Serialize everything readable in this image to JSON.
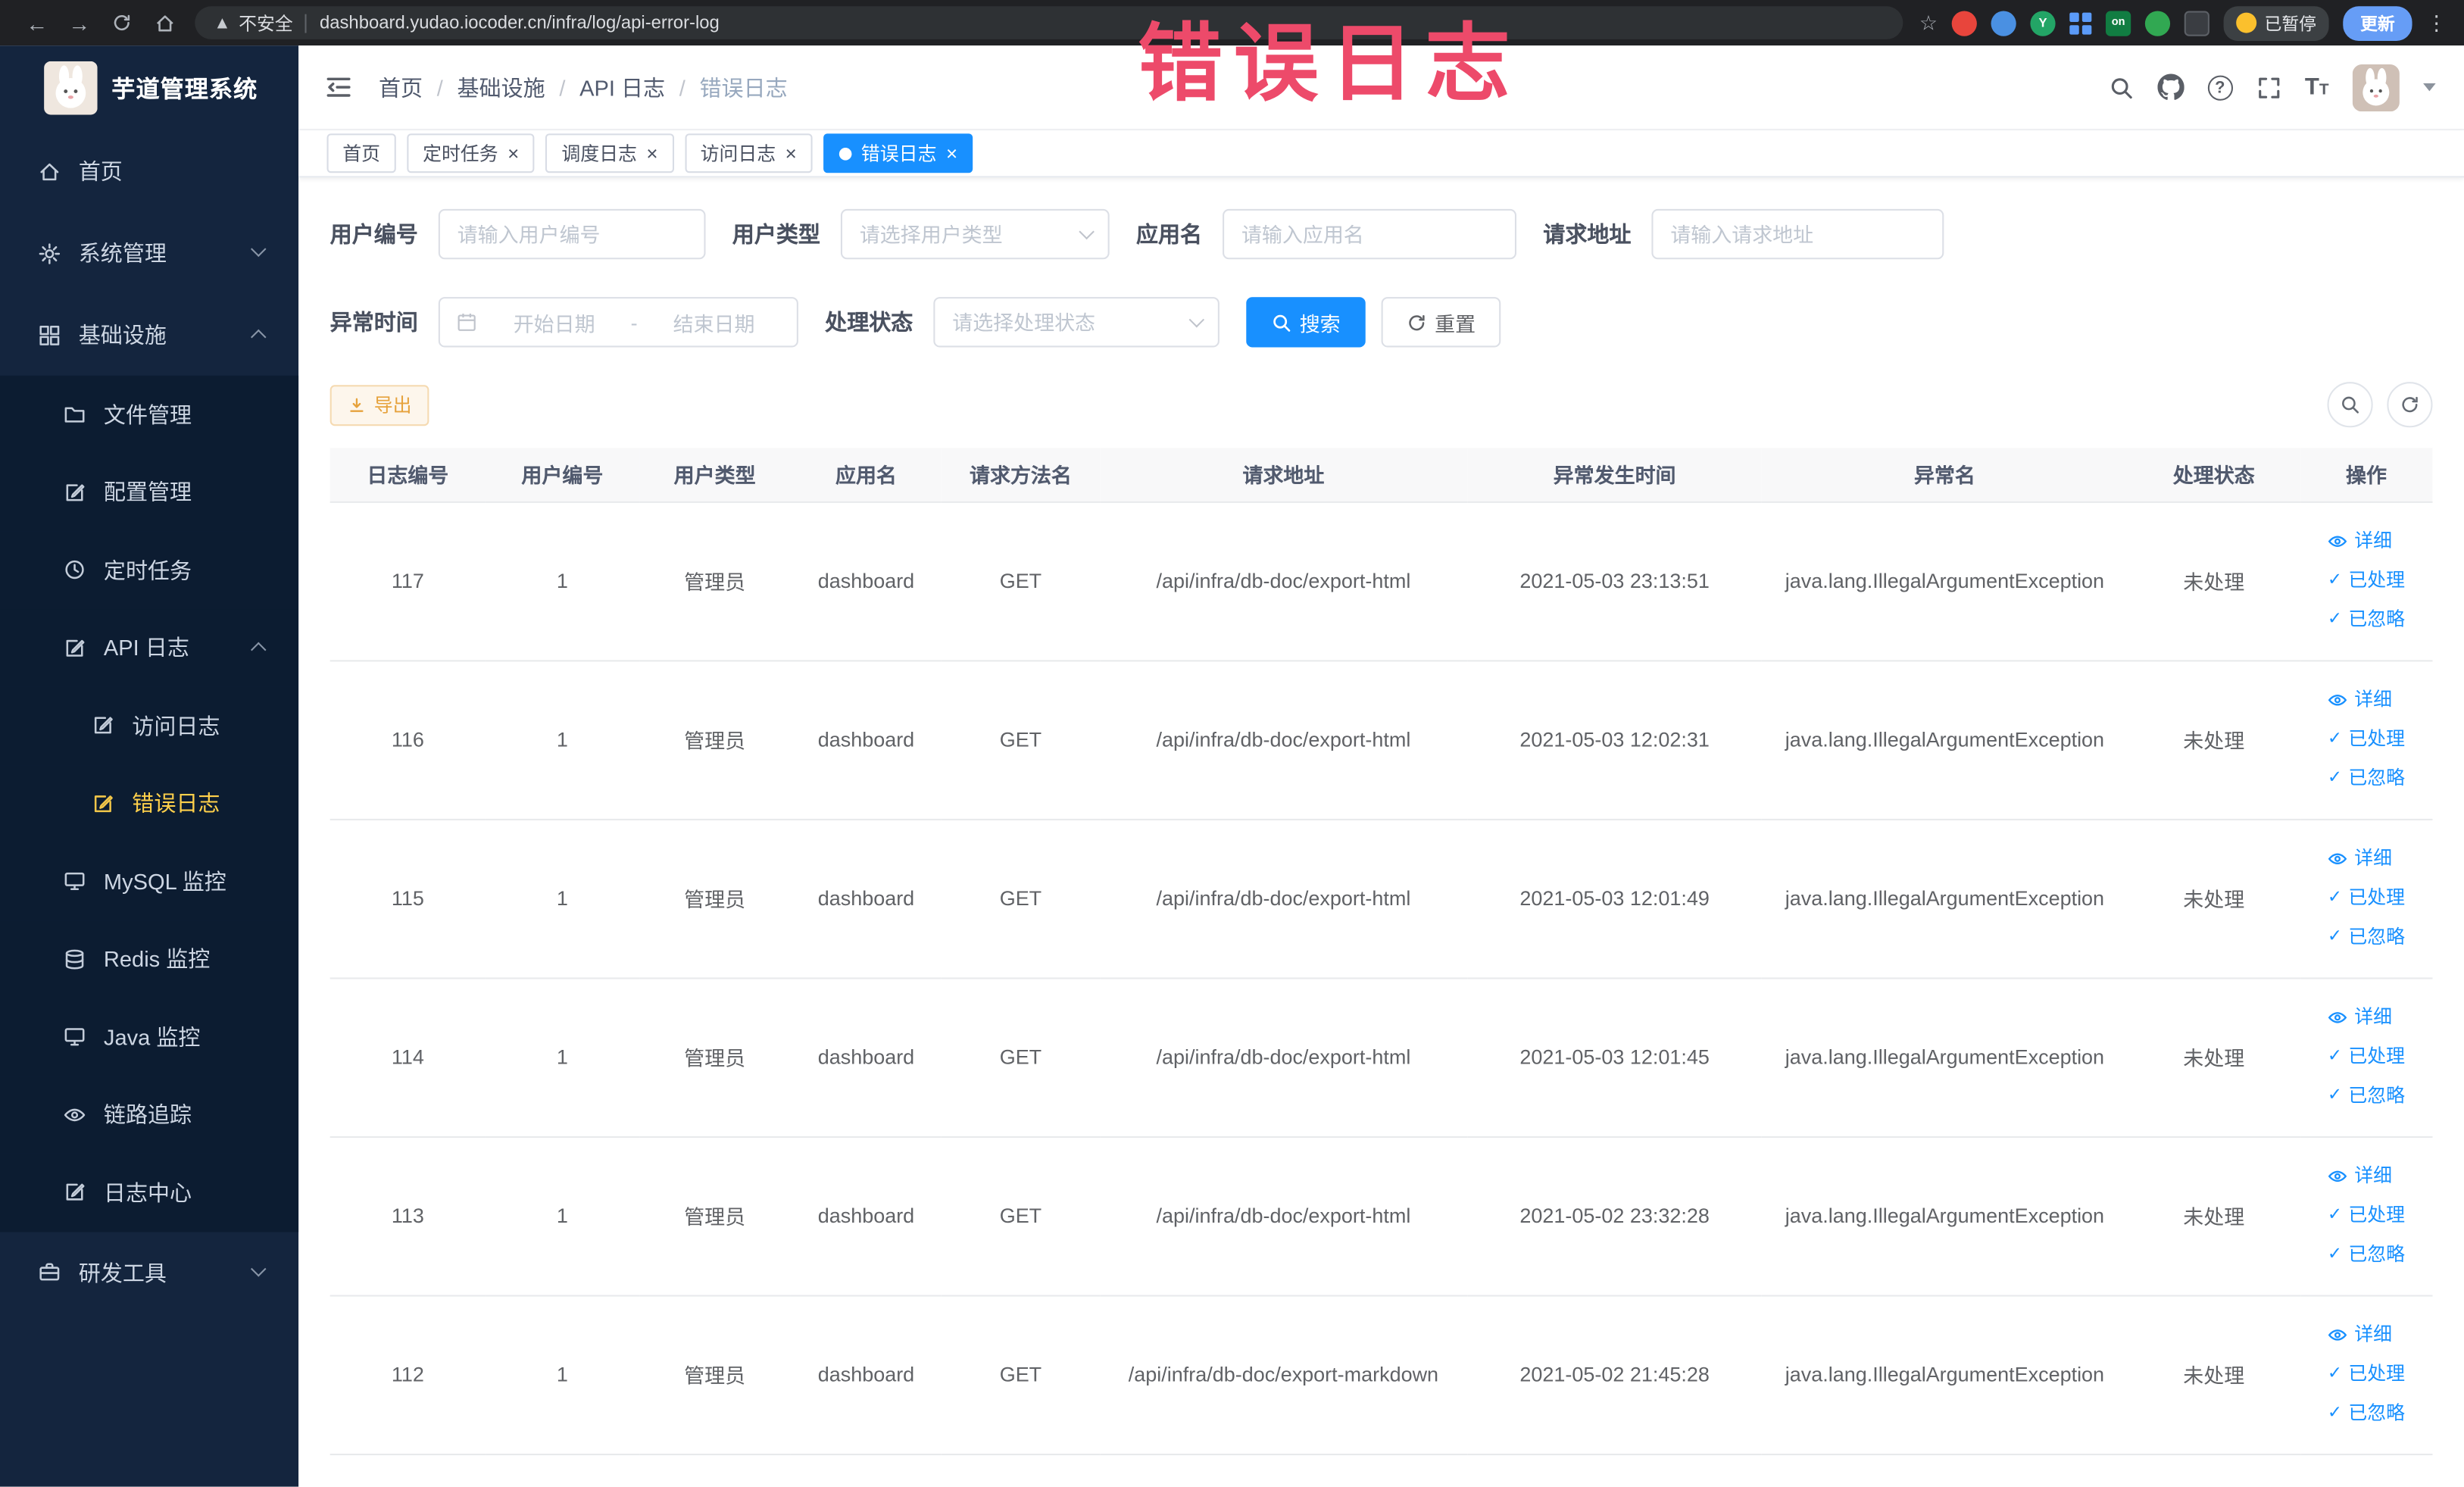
{
  "browser": {
    "security_label": "不安全",
    "url": "dashboard.yudao.iocoder.cn/infra/log/api-error-log",
    "paused_badge": "已暂停",
    "update_button": "更新",
    "extension_letter": "Y",
    "extension_on_badge": "on"
  },
  "annotation": {
    "text": "错误日志",
    "color": "#ed4a6a"
  },
  "sidebar": {
    "app_title": "芋道管理系统",
    "items": [
      {
        "key": "home",
        "label": "首页",
        "icon": "home-icon",
        "depth": 0,
        "dark": false
      },
      {
        "key": "system",
        "label": "系统管理",
        "icon": "gear-icon",
        "depth": 0,
        "dark": false,
        "arrow": "down"
      },
      {
        "key": "infra",
        "label": "基础设施",
        "icon": "grid-icon",
        "depth": 0,
        "dark": false,
        "arrow": "up"
      },
      {
        "key": "file",
        "label": "文件管理",
        "icon": "folder-icon",
        "depth": 1,
        "dark": true
      },
      {
        "key": "config",
        "label": "配置管理",
        "icon": "edit-square-icon",
        "depth": 1,
        "dark": true
      },
      {
        "key": "job",
        "label": "定时任务",
        "icon": "clock-icon",
        "depth": 1,
        "dark": true
      },
      {
        "key": "api-log",
        "label": "API 日志",
        "icon": "edit-square-icon",
        "depth": 1,
        "dark": true,
        "arrow": "up"
      },
      {
        "key": "access-log",
        "label": "访问日志",
        "icon": "edit-square-icon",
        "depth": 2,
        "dark": true
      },
      {
        "key": "error-log",
        "label": "错误日志",
        "icon": "edit-square-icon",
        "depth": 2,
        "dark": true,
        "active": true
      },
      {
        "key": "mysql",
        "label": "MySQL 监控",
        "icon": "monitor-icon",
        "depth": 1,
        "dark": true
      },
      {
        "key": "redis",
        "label": "Redis 监控",
        "icon": "database-icon",
        "depth": 1,
        "dark": true
      },
      {
        "key": "java",
        "label": "Java 监控",
        "icon": "monitor-icon",
        "depth": 1,
        "dark": true
      },
      {
        "key": "trace",
        "label": "链路追踪",
        "icon": "eye-icon",
        "depth": 1,
        "dark": true
      },
      {
        "key": "log-center",
        "label": "日志中心",
        "icon": "edit-square-icon",
        "depth": 1,
        "dark": true
      },
      {
        "key": "dev-tools",
        "label": "研发工具",
        "icon": "briefcase-icon",
        "depth": 0,
        "dark": false,
        "arrow": "down"
      }
    ]
  },
  "breadcrumb": {
    "items": [
      "首页",
      "基础设施",
      "API 日志",
      "错误日志"
    ]
  },
  "tags": [
    {
      "key": "home",
      "label": "首页",
      "closable": false,
      "active": false
    },
    {
      "key": "job",
      "label": "定时任务",
      "closable": true,
      "active": false
    },
    {
      "key": "job-log",
      "label": "调度日志",
      "closable": true,
      "active": false
    },
    {
      "key": "access-log",
      "label": "访问日志",
      "closable": true,
      "active": false
    },
    {
      "key": "error-log",
      "label": "错误日志",
      "closable": true,
      "active": true
    }
  ],
  "filters": {
    "user_id_label": "用户编号",
    "user_id_placeholder": "请输入用户编号",
    "user_type_label": "用户类型",
    "user_type_placeholder": "请选择用户类型",
    "app_name_label": "应用名",
    "app_name_placeholder": "请输入应用名",
    "request_url_label": "请求地址",
    "request_url_placeholder": "请输入请求地址",
    "exception_time_label": "异常时间",
    "start_date_placeholder": "开始日期",
    "date_separator": "-",
    "end_date_placeholder": "结束日期",
    "process_status_label": "处理状态",
    "process_status_placeholder": "请选择处理状态",
    "search_button": "搜索",
    "reset_button": "重置"
  },
  "toolbar": {
    "export_button": "导出"
  },
  "table": {
    "columns": [
      "日志编号",
      "用户编号",
      "用户类型",
      "应用名",
      "请求方法名",
      "请求地址",
      "异常发生时间",
      "异常名",
      "处理状态",
      "操作"
    ],
    "row_actions": {
      "detail": "详细",
      "processed": "已处理",
      "ignored": "已忽略"
    },
    "rows": [
      {
        "id": "117",
        "user_id": "1",
        "user_type": "管理员",
        "app_name": "dashboard",
        "method": "GET",
        "url": "/api/infra/db-doc/export-html",
        "time": "2021-05-03 23:13:51",
        "exception": "java.lang.IllegalArgumentException",
        "status": "未处理"
      },
      {
        "id": "116",
        "user_id": "1",
        "user_type": "管理员",
        "app_name": "dashboard",
        "method": "GET",
        "url": "/api/infra/db-doc/export-html",
        "time": "2021-05-03 12:02:31",
        "exception": "java.lang.IllegalArgumentException",
        "status": "未处理"
      },
      {
        "id": "115",
        "user_id": "1",
        "user_type": "管理员",
        "app_name": "dashboard",
        "method": "GET",
        "url": "/api/infra/db-doc/export-html",
        "time": "2021-05-03 12:01:49",
        "exception": "java.lang.IllegalArgumentException",
        "status": "未处理"
      },
      {
        "id": "114",
        "user_id": "1",
        "user_type": "管理员",
        "app_name": "dashboard",
        "method": "GET",
        "url": "/api/infra/db-doc/export-html",
        "time": "2021-05-03 12:01:45",
        "exception": "java.lang.IllegalArgumentException",
        "status": "未处理"
      },
      {
        "id": "113",
        "user_id": "1",
        "user_type": "管理员",
        "app_name": "dashboard",
        "method": "GET",
        "url": "/api/infra/db-doc/export-html",
        "time": "2021-05-02 23:32:28",
        "exception": "java.lang.IllegalArgumentException",
        "status": "未处理"
      },
      {
        "id": "112",
        "user_id": "1",
        "user_type": "管理员",
        "app_name": "dashboard",
        "method": "GET",
        "url": "/api/infra/db-doc/export-markdown",
        "time": "2021-05-02 21:45:28",
        "exception": "java.lang.IllegalArgumentException",
        "status": "未处理"
      }
    ]
  },
  "colors": {
    "primary": "#1890ff",
    "sidebar_bg": "#14253e",
    "sidebar_submenu_bg": "#0c1c31",
    "sidebar_active_text": "#ffd04b",
    "warning_text": "#e6a23c",
    "annotation": "#ed4a6a"
  }
}
